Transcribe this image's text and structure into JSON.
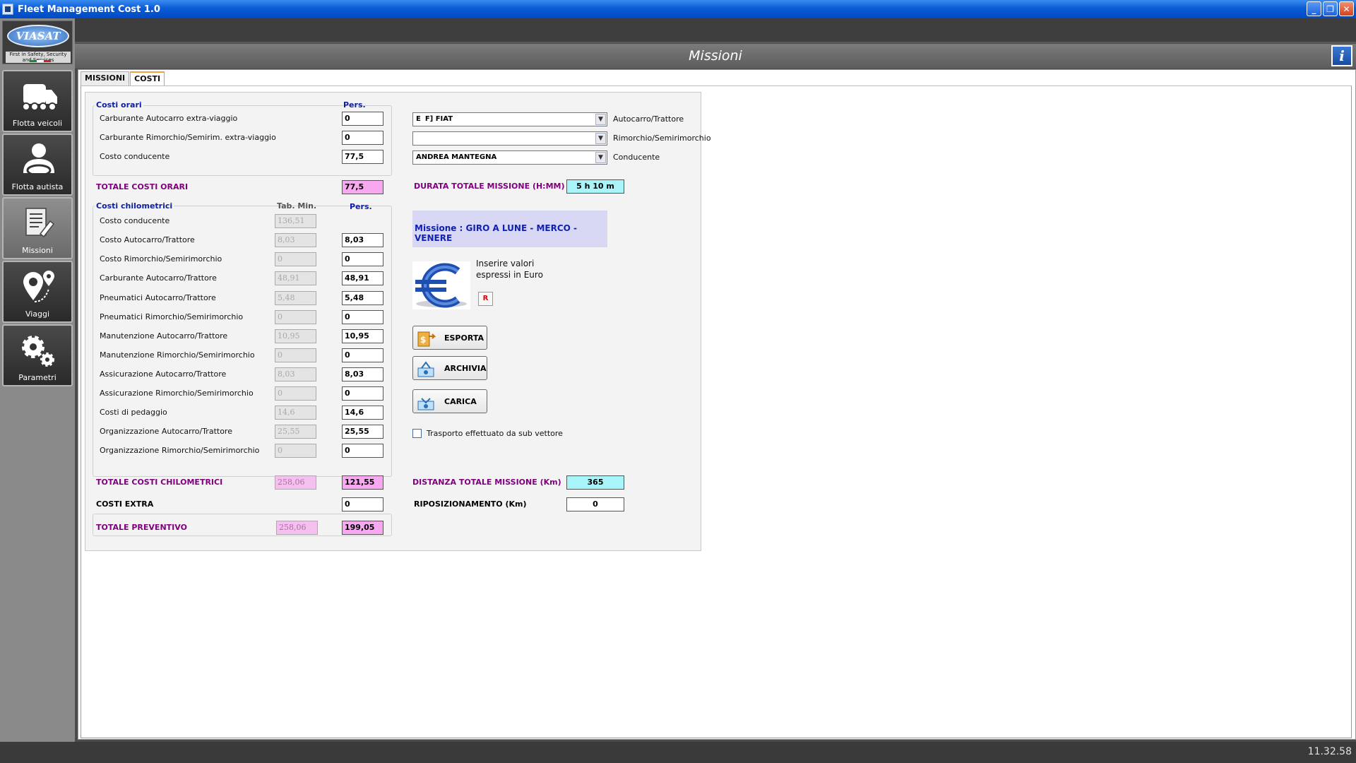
{
  "window": {
    "title": "Fleet Management Cost 1.0"
  },
  "logo": {
    "brand": "VIASAT",
    "tagline": "First in Safety, Security and Services"
  },
  "sidebar": {
    "items": [
      {
        "label": "Flotta veicoli",
        "icon": "truck-icon"
      },
      {
        "label": "Flotta autista",
        "icon": "driver-icon"
      },
      {
        "label": "Missioni",
        "icon": "document-icon"
      },
      {
        "label": "Viaggi",
        "icon": "map-pin-icon"
      },
      {
        "label": "Parametri",
        "icon": "gears-icon"
      }
    ]
  },
  "header": {
    "title": "Missioni",
    "info": "i"
  },
  "tabs": [
    "MISSIONI",
    "COSTI"
  ],
  "costi_orari": {
    "group_label": "Costi orari",
    "pers_header": "Pers.",
    "rows": [
      {
        "label": "Carburante Autocarro extra-viaggio",
        "value": "0"
      },
      {
        "label": "Carburante Rimorchio/Semirim. extra-viaggio",
        "value": "0"
      },
      {
        "label": "Costo conducente",
        "value": "77,5"
      }
    ],
    "total_label": "TOTALE COSTI ORARI",
    "total_value": "77,5"
  },
  "costi_km": {
    "group_label": "Costi chilometrici",
    "tab_header": "Tab. Min.",
    "pers_header": "Pers.",
    "rows": [
      {
        "label": "Costo conducente",
        "tab": "136,51",
        "pers": ""
      },
      {
        "label": "Costo Autocarro/Trattore",
        "tab": "8,03",
        "pers": "8,03"
      },
      {
        "label": "Costo Rimorchio/Semirimorchio",
        "tab": "0",
        "pers": "0"
      },
      {
        "label": "Carburante Autocarro/Trattore",
        "tab": "48,91",
        "pers": "48,91"
      },
      {
        "label": "Pneumatici Autocarro/Trattore",
        "tab": "5,48",
        "pers": "5,48"
      },
      {
        "label": "Pneumatici Rimorchio/Semirimorchio",
        "tab": "0",
        "pers": "0"
      },
      {
        "label": "Manutenzione Autocarro/Trattore",
        "tab": "10,95",
        "pers": "10,95"
      },
      {
        "label": "Manutenzione Rimorchio/Semirimorchio",
        "tab": "0",
        "pers": "0"
      },
      {
        "label": "Assicurazione Autocarro/Trattore",
        "tab": "8,03",
        "pers": "8,03"
      },
      {
        "label": "Assicurazione Rimorchio/Semirimorchio",
        "tab": "0",
        "pers": "0"
      },
      {
        "label": "Costi di pedaggio",
        "tab": "14,6",
        "pers": "14,6"
      },
      {
        "label": "Organizzazione Autocarro/Trattore",
        "tab": "25,55",
        "pers": "25,55"
      },
      {
        "label": "Organizzazione Rimorchio/Semirimorchio",
        "tab": "0",
        "pers": "0"
      }
    ],
    "total_label": "TOTALE COSTI CHILOMETRICI",
    "total_tab": "258,06",
    "total_pers": "121,55"
  },
  "extra": {
    "label": "COSTI EXTRA",
    "value": "0"
  },
  "preventivo": {
    "label": "TOTALE PREVENTIVO",
    "tab": "258,06",
    "pers": "199,05"
  },
  "selectors": [
    {
      "value": "E   F] FIAT",
      "label": "Autocarro/Trattore"
    },
    {
      "value": "",
      "label": "Rimorchio/Semirimorchio"
    },
    {
      "value": "ANDREA MANTEGNA",
      "label": "Conducente"
    }
  ],
  "durata": {
    "label": "DURATA TOTALE MISSIONE (H:MM)",
    "value": "5 h 10 m"
  },
  "missione": {
    "text": "Missione : GIRO A LUNE - MERCO - VENERE"
  },
  "euro_note": {
    "line1": "Inserire valori",
    "line2": "espressi in Euro",
    "reset": "R"
  },
  "buttons": {
    "esporta": "ESPORTA",
    "archivia": "ARCHIVIA",
    "carica": "CARICA"
  },
  "checkbox": {
    "label": "Trasporto effettuato da sub vettore",
    "checked": false
  },
  "distanza": {
    "label": "DISTANZA TOTALE MISSIONE (Km)",
    "value": "365"
  },
  "riposizionamento": {
    "label": "RIPOSIZIONAMENTO (Km)",
    "value": "0"
  },
  "status": {
    "clock": "11.32.58"
  }
}
